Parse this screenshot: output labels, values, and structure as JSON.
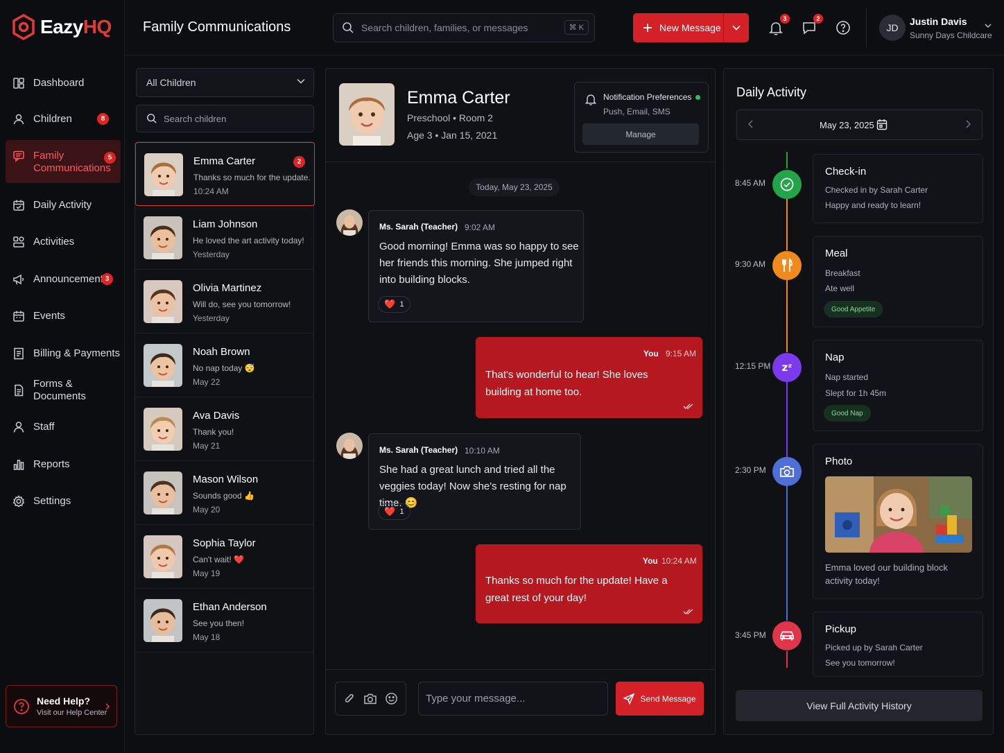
{
  "app": {
    "logo_prefix": "Eazy",
    "logo_suffix": "HQ",
    "page_title": "Family Communications",
    "brand_color": "#e53935"
  },
  "sidebar": {
    "items": [
      {
        "label": "Dashboard",
        "icon": "dashboard-icon"
      },
      {
        "label": "Children",
        "icon": "children-icon",
        "badge": "8"
      },
      {
        "label": "Family\nCommunications",
        "label_line1": "Family",
        "label_line2": "Communications",
        "icon": "chat-icon",
        "badge": "5",
        "active": true
      },
      {
        "label": "Daily Activity",
        "icon": "calendar-check-icon"
      },
      {
        "label": "Activities",
        "icon": "activities-icon"
      },
      {
        "label": "Announcements",
        "icon": "megaphone-icon",
        "badge": "3"
      },
      {
        "label": "Events",
        "icon": "calendar-icon"
      },
      {
        "label": "Billing & Payments",
        "icon": "billing-icon"
      },
      {
        "label": "Forms & Documents",
        "icon": "document-icon"
      },
      {
        "label": "Staff",
        "icon": "staff-icon"
      },
      {
        "label": "Reports",
        "icon": "reports-icon"
      },
      {
        "label": "Settings",
        "icon": "gear-icon"
      }
    ],
    "help": {
      "title": "Need Help?",
      "subtitle": "Visit our Help Center"
    }
  },
  "header": {
    "search_placeholder": "Search children, families, or messages",
    "search_shortcut": "⌘ K",
    "new_message_label": "New Message",
    "notifications_count": "3",
    "messages_count": "2",
    "user": {
      "initials": "JD",
      "name": "Justin Davis",
      "org": "Sunny Days Childcare"
    }
  },
  "children_panel": {
    "filter_value": "All Children",
    "search_placeholder": "Search children",
    "children": [
      {
        "name": "Emma Carter",
        "preview": "Thanks so much for the update...",
        "time": "10:24 AM",
        "unread": "2",
        "active": true
      },
      {
        "name": "Liam Johnson",
        "preview": "He loved the art activity today!",
        "time": "Yesterday"
      },
      {
        "name": "Olivia Martinez",
        "preview": "Will do, see you tomorrow!",
        "time": "Yesterday"
      },
      {
        "name": "Noah Brown",
        "preview": "No nap today 😴",
        "time": "May 22"
      },
      {
        "name": "Ava Davis",
        "preview": "Thank you!",
        "time": "May 21"
      },
      {
        "name": "Mason Wilson",
        "preview": "Sounds good 👍",
        "time": "May 20"
      },
      {
        "name": "Sophia Taylor",
        "preview": "Can't wait! ❤️",
        "time": "May 19"
      },
      {
        "name": "Ethan Anderson",
        "preview": "See you then!",
        "time": "May 18"
      }
    ]
  },
  "conversation": {
    "child": {
      "name": "Emma Carter",
      "class": "Preschool • Room 2",
      "age": "Age 3 • Jan 15, 2021"
    },
    "notifications": {
      "title": "Notification Preferences",
      "channels": "Push, Email, SMS",
      "manage_label": "Manage"
    },
    "date_divider": "Today, May 23, 2025",
    "messages": [
      {
        "direction": "in",
        "sender": "Ms. Sarah (Teacher)",
        "time": "9:02 AM",
        "text": "Good morning! Emma was so happy to see her friends this morning. She jumped right into building blocks.",
        "reaction": "❤️",
        "reaction_count": "1"
      },
      {
        "direction": "out",
        "sender": "You",
        "time": "9:15 AM",
        "text": "That's wonderful to hear! She loves building at home too."
      },
      {
        "direction": "in",
        "sender": "Ms. Sarah (Teacher)",
        "time": "10:10 AM",
        "text": "She had a great lunch and tried all the veggies today! Now she's resting for nap time. 😊",
        "reaction": "❤️",
        "reaction_count": "1"
      },
      {
        "direction": "out",
        "sender": "You",
        "time": "10:24 AM",
        "text": "Thanks so much for the update! Have a great rest of your day!"
      }
    ],
    "composer_placeholder": "Type your message...",
    "send_label": "Send Message"
  },
  "daily_activity": {
    "title": "Daily Activity",
    "date": "May 23, 2025",
    "events": [
      {
        "time": "8:45 AM",
        "title": "Check-in",
        "line1": "Checked in by Sarah Carter",
        "line2": "Happy and ready to learn!",
        "color": "#22a447",
        "icon": "check-circle-icon"
      },
      {
        "time": "9:30 AM",
        "title": "Meal",
        "line1": "Breakfast",
        "line2": "Ate well",
        "tag": "Good Appetite",
        "color": "#f08a1c",
        "icon": "utensils-icon"
      },
      {
        "time": "12:15 PM",
        "title": "Nap",
        "line1": "Nap started",
        "line2": "Slept for 1h 45m",
        "tag": "Good Nap",
        "color": "#7c3aed",
        "icon": "zzz-icon"
      },
      {
        "time": "2:30 PM",
        "title": "Photo",
        "caption": "Emma loved our building block activity today!",
        "color": "#4f6fd8",
        "icon": "camera-icon"
      },
      {
        "time": "3:45 PM",
        "title": "Pickup",
        "line1": "Picked up by Sarah Carter",
        "line2": "See you tomorrow!",
        "color": "#e0354b",
        "icon": "car-icon"
      }
    ],
    "history_label": "View Full Activity History"
  }
}
